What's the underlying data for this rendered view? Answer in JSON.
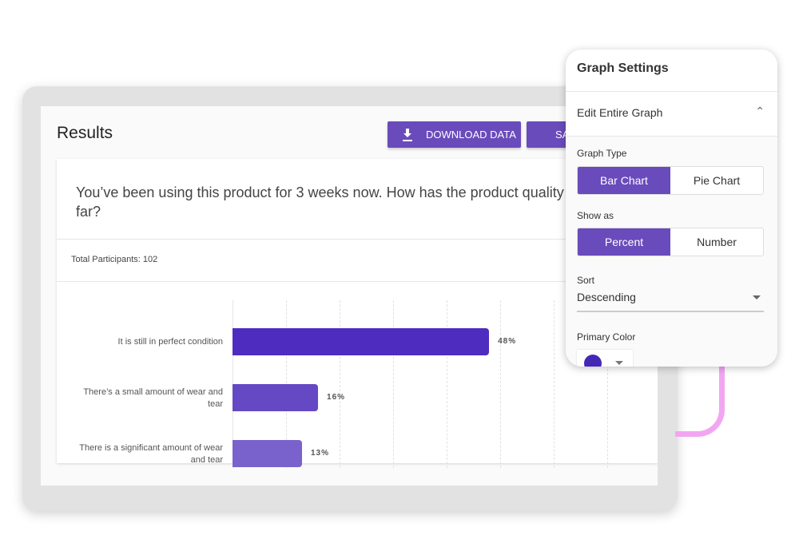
{
  "results": {
    "title": "Results",
    "download_label": "DOWNLOAD DATA",
    "second_button_label": "SA",
    "question": "You’ve been using this product for 3 weeks now. How has the product quality held up so far?",
    "total_participants": "Total Participants: 102"
  },
  "chart_data": {
    "type": "bar",
    "orientation": "horizontal",
    "categories": [
      "It is still in perfect condition",
      "There’s a small amount of wear and tear",
      "There is a significant amount of wear and tear"
    ],
    "values": [
      48,
      16,
      13
    ],
    "value_labels": [
      "48%",
      "16%",
      "13%"
    ],
    "colors": [
      "#4f2cc0",
      "#6548c4",
      "#7a62cc"
    ],
    "grid": true
  },
  "settings": {
    "title": "Graph Settings",
    "section": "Edit Entire Graph",
    "graph_type_label": "Graph Type",
    "graph_types": [
      "Bar Chart",
      "Pie Chart"
    ],
    "show_as_label": "Show as",
    "show_as": [
      "Percent",
      "Number"
    ],
    "sort_label": "Sort",
    "sort_value": "Descending",
    "primary_color_label": "Primary Color",
    "primary_color": "#4527b8",
    "accent": "#6a4bbb"
  }
}
